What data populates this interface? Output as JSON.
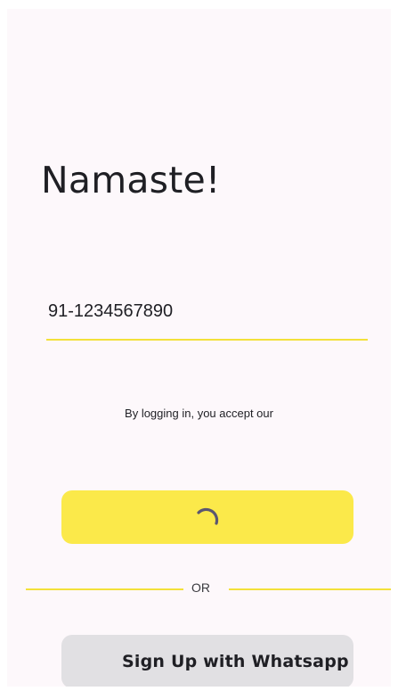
{
  "greeting": {
    "title": "Namaste!"
  },
  "login_form": {
    "phone_value": "91-1234567890",
    "terms_text": "By logging in, you accept our",
    "login_button": {
      "state": "loading",
      "icon": "loading-spinner-icon"
    }
  },
  "divider": {
    "label": "OR"
  },
  "whatsapp": {
    "button_label": "Sign Up with Whatsapp"
  },
  "colors": {
    "screen_background": "#fdf8fb",
    "accent_yellow": "#fbe94a",
    "underline_yellow": "#f3e13a",
    "secondary_button": "#e1e0e3",
    "spinner": "#5b5670",
    "text": "#1f1f24"
  }
}
